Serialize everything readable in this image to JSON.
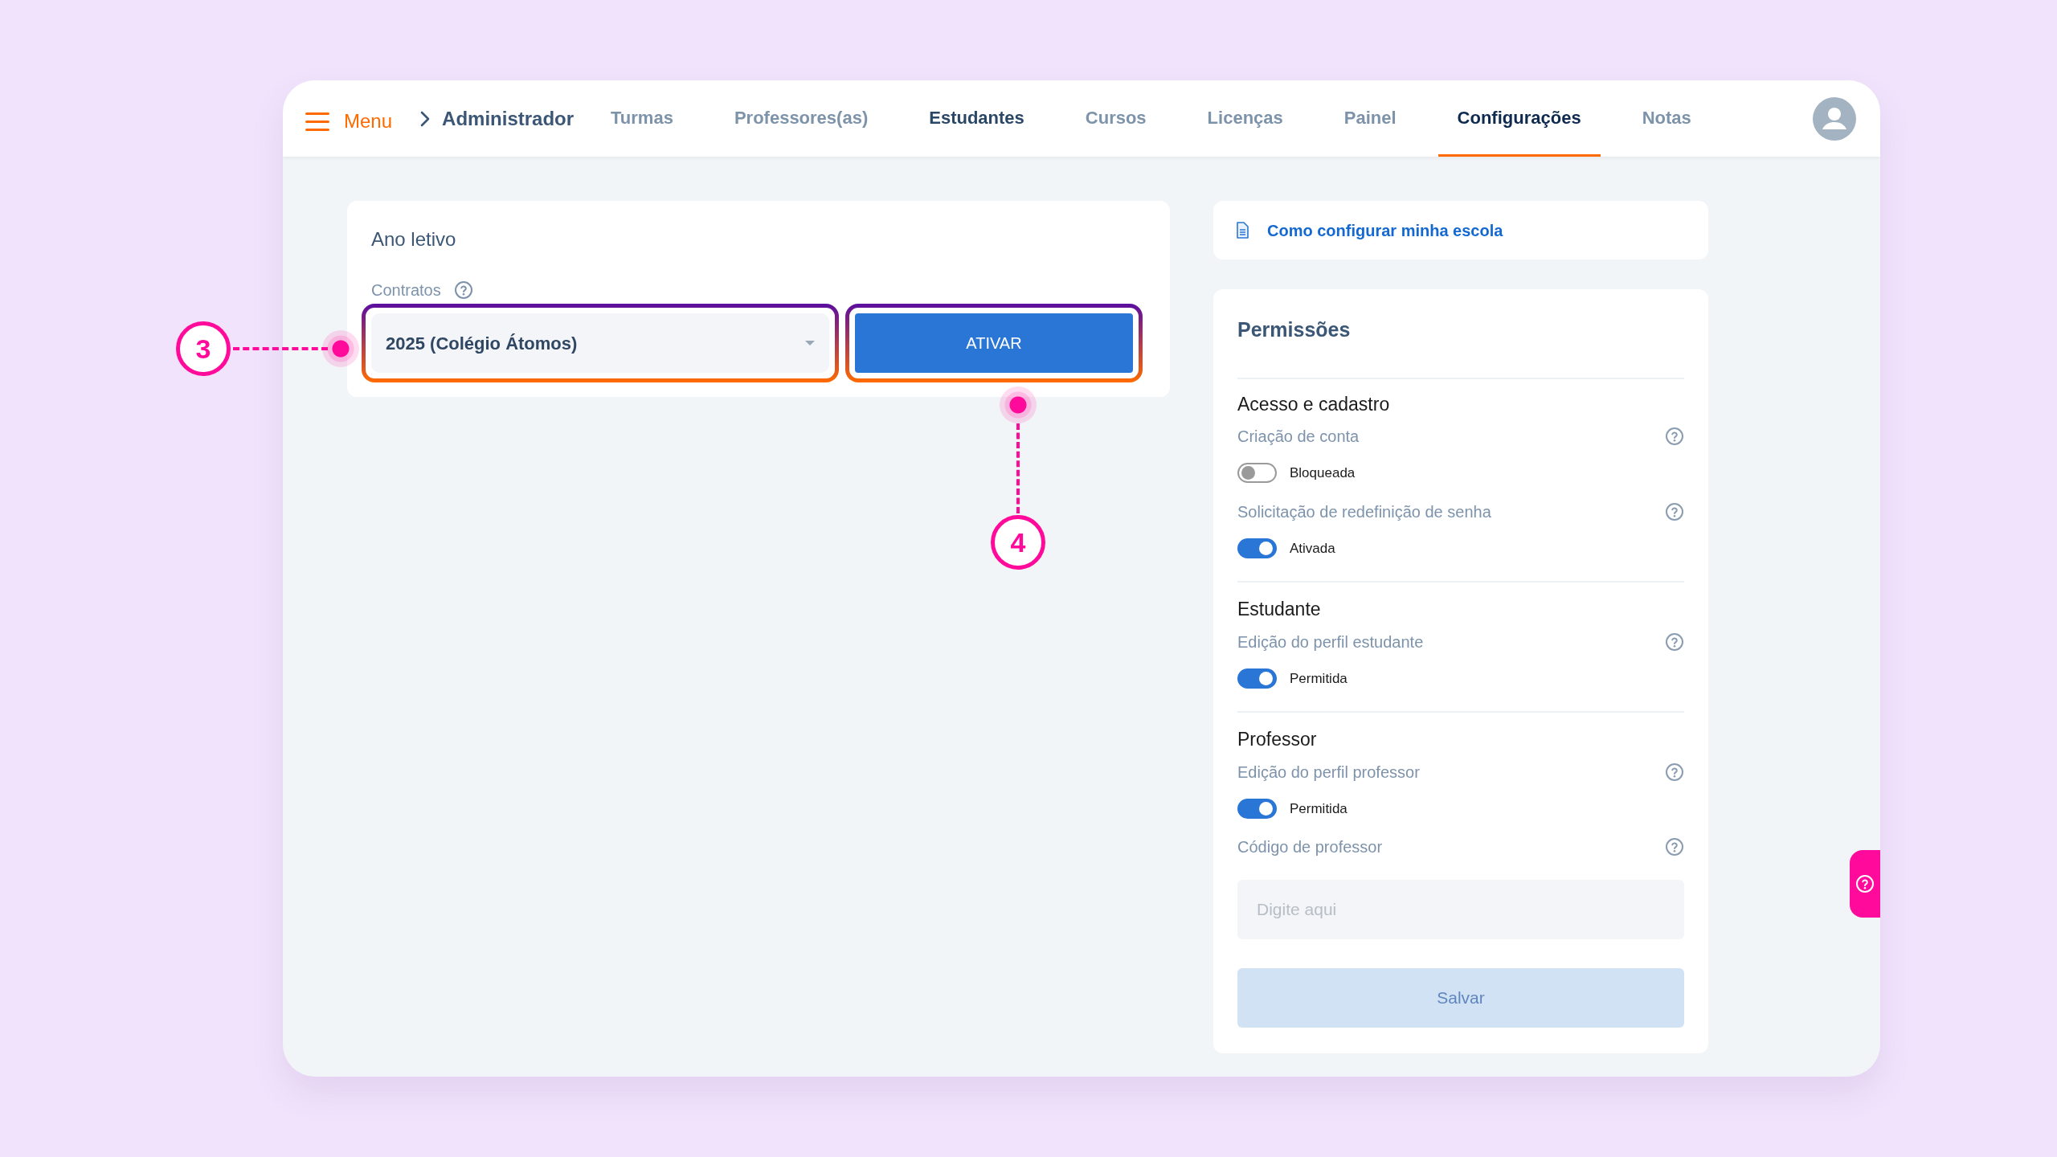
{
  "nav": {
    "menu_label": "Menu",
    "breadcrumb": "Administrador",
    "tabs": [
      {
        "label": "Turmas",
        "selected": false,
        "emphasized": false
      },
      {
        "label": "Professores(as)",
        "selected": false,
        "emphasized": false
      },
      {
        "label": "Estudantes",
        "selected": false,
        "emphasized": true
      },
      {
        "label": "Cursos",
        "selected": false,
        "emphasized": false
      },
      {
        "label": "Licenças",
        "selected": false,
        "emphasized": false
      },
      {
        "label": "Painel",
        "selected": false,
        "emphasized": false
      },
      {
        "label": "Configurações",
        "selected": true,
        "emphasized": false
      },
      {
        "label": "Notas",
        "selected": false,
        "emphasized": false
      }
    ]
  },
  "school_year": {
    "title": "Ano letivo",
    "field_label": "Contratos",
    "select": {
      "value": "2025 (Colégio Átomos)",
      "highlighted": true
    },
    "button": {
      "label": "ATIVAR",
      "highlighted": true
    }
  },
  "help_link": "Como configurar minha escola",
  "permissions": {
    "title": "Permissões",
    "sections": [
      {
        "title": "Acesso e cadastro",
        "settings": [
          {
            "kind": "toggle",
            "label": "Criação de conta",
            "on": false,
            "state_label": "Bloqueada"
          },
          {
            "kind": "toggle",
            "label": "Solicitação de redefinição de senha",
            "on": true,
            "state_label": "Ativada"
          }
        ]
      },
      {
        "title": "Estudante",
        "settings": [
          {
            "kind": "toggle",
            "label": "Edição do perfil estudante",
            "on": true,
            "state_label": "Permitida"
          }
        ]
      },
      {
        "title": "Professor",
        "settings": [
          {
            "kind": "toggle",
            "label": "Edição do perfil professor",
            "on": true,
            "state_label": "Permitida"
          },
          {
            "kind": "input",
            "label": "Código de professor",
            "placeholder": "Digite aqui"
          }
        ]
      }
    ],
    "save_button": {
      "label": "Salvar",
      "disabled": true
    }
  },
  "callouts": [
    {
      "number": "3"
    },
    {
      "number": "4"
    }
  ]
}
